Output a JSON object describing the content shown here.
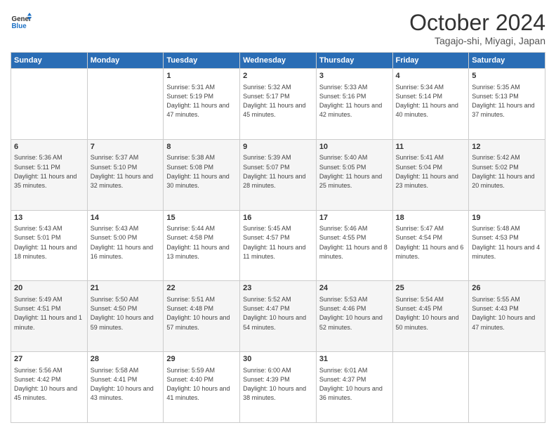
{
  "logo": {
    "text_general": "General",
    "text_blue": "Blue"
  },
  "header": {
    "month": "October 2024",
    "location": "Tagajo-shi, Miyagi, Japan"
  },
  "weekdays": [
    "Sunday",
    "Monday",
    "Tuesday",
    "Wednesday",
    "Thursday",
    "Friday",
    "Saturday"
  ],
  "rows": [
    [
      {
        "day": "",
        "sunrise": "",
        "sunset": "",
        "daylight": ""
      },
      {
        "day": "",
        "sunrise": "",
        "sunset": "",
        "daylight": ""
      },
      {
        "day": "1",
        "sunrise": "Sunrise: 5:31 AM",
        "sunset": "Sunset: 5:19 PM",
        "daylight": "Daylight: 11 hours and 47 minutes."
      },
      {
        "day": "2",
        "sunrise": "Sunrise: 5:32 AM",
        "sunset": "Sunset: 5:17 PM",
        "daylight": "Daylight: 11 hours and 45 minutes."
      },
      {
        "day": "3",
        "sunrise": "Sunrise: 5:33 AM",
        "sunset": "Sunset: 5:16 PM",
        "daylight": "Daylight: 11 hours and 42 minutes."
      },
      {
        "day": "4",
        "sunrise": "Sunrise: 5:34 AM",
        "sunset": "Sunset: 5:14 PM",
        "daylight": "Daylight: 11 hours and 40 minutes."
      },
      {
        "day": "5",
        "sunrise": "Sunrise: 5:35 AM",
        "sunset": "Sunset: 5:13 PM",
        "daylight": "Daylight: 11 hours and 37 minutes."
      }
    ],
    [
      {
        "day": "6",
        "sunrise": "Sunrise: 5:36 AM",
        "sunset": "Sunset: 5:11 PM",
        "daylight": "Daylight: 11 hours and 35 minutes."
      },
      {
        "day": "7",
        "sunrise": "Sunrise: 5:37 AM",
        "sunset": "Sunset: 5:10 PM",
        "daylight": "Daylight: 11 hours and 32 minutes."
      },
      {
        "day": "8",
        "sunrise": "Sunrise: 5:38 AM",
        "sunset": "Sunset: 5:08 PM",
        "daylight": "Daylight: 11 hours and 30 minutes."
      },
      {
        "day": "9",
        "sunrise": "Sunrise: 5:39 AM",
        "sunset": "Sunset: 5:07 PM",
        "daylight": "Daylight: 11 hours and 28 minutes."
      },
      {
        "day": "10",
        "sunrise": "Sunrise: 5:40 AM",
        "sunset": "Sunset: 5:05 PM",
        "daylight": "Daylight: 11 hours and 25 minutes."
      },
      {
        "day": "11",
        "sunrise": "Sunrise: 5:41 AM",
        "sunset": "Sunset: 5:04 PM",
        "daylight": "Daylight: 11 hours and 23 minutes."
      },
      {
        "day": "12",
        "sunrise": "Sunrise: 5:42 AM",
        "sunset": "Sunset: 5:02 PM",
        "daylight": "Daylight: 11 hours and 20 minutes."
      }
    ],
    [
      {
        "day": "13",
        "sunrise": "Sunrise: 5:43 AM",
        "sunset": "Sunset: 5:01 PM",
        "daylight": "Daylight: 11 hours and 18 minutes."
      },
      {
        "day": "14",
        "sunrise": "Sunrise: 5:43 AM",
        "sunset": "Sunset: 5:00 PM",
        "daylight": "Daylight: 11 hours and 16 minutes."
      },
      {
        "day": "15",
        "sunrise": "Sunrise: 5:44 AM",
        "sunset": "Sunset: 4:58 PM",
        "daylight": "Daylight: 11 hours and 13 minutes."
      },
      {
        "day": "16",
        "sunrise": "Sunrise: 5:45 AM",
        "sunset": "Sunset: 4:57 PM",
        "daylight": "Daylight: 11 hours and 11 minutes."
      },
      {
        "day": "17",
        "sunrise": "Sunrise: 5:46 AM",
        "sunset": "Sunset: 4:55 PM",
        "daylight": "Daylight: 11 hours and 8 minutes."
      },
      {
        "day": "18",
        "sunrise": "Sunrise: 5:47 AM",
        "sunset": "Sunset: 4:54 PM",
        "daylight": "Daylight: 11 hours and 6 minutes."
      },
      {
        "day": "19",
        "sunrise": "Sunrise: 5:48 AM",
        "sunset": "Sunset: 4:53 PM",
        "daylight": "Daylight: 11 hours and 4 minutes."
      }
    ],
    [
      {
        "day": "20",
        "sunrise": "Sunrise: 5:49 AM",
        "sunset": "Sunset: 4:51 PM",
        "daylight": "Daylight: 11 hours and 1 minute."
      },
      {
        "day": "21",
        "sunrise": "Sunrise: 5:50 AM",
        "sunset": "Sunset: 4:50 PM",
        "daylight": "Daylight: 10 hours and 59 minutes."
      },
      {
        "day": "22",
        "sunrise": "Sunrise: 5:51 AM",
        "sunset": "Sunset: 4:48 PM",
        "daylight": "Daylight: 10 hours and 57 minutes."
      },
      {
        "day": "23",
        "sunrise": "Sunrise: 5:52 AM",
        "sunset": "Sunset: 4:47 PM",
        "daylight": "Daylight: 10 hours and 54 minutes."
      },
      {
        "day": "24",
        "sunrise": "Sunrise: 5:53 AM",
        "sunset": "Sunset: 4:46 PM",
        "daylight": "Daylight: 10 hours and 52 minutes."
      },
      {
        "day": "25",
        "sunrise": "Sunrise: 5:54 AM",
        "sunset": "Sunset: 4:45 PM",
        "daylight": "Daylight: 10 hours and 50 minutes."
      },
      {
        "day": "26",
        "sunrise": "Sunrise: 5:55 AM",
        "sunset": "Sunset: 4:43 PM",
        "daylight": "Daylight: 10 hours and 47 minutes."
      }
    ],
    [
      {
        "day": "27",
        "sunrise": "Sunrise: 5:56 AM",
        "sunset": "Sunset: 4:42 PM",
        "daylight": "Daylight: 10 hours and 45 minutes."
      },
      {
        "day": "28",
        "sunrise": "Sunrise: 5:58 AM",
        "sunset": "Sunset: 4:41 PM",
        "daylight": "Daylight: 10 hours and 43 minutes."
      },
      {
        "day": "29",
        "sunrise": "Sunrise: 5:59 AM",
        "sunset": "Sunset: 4:40 PM",
        "daylight": "Daylight: 10 hours and 41 minutes."
      },
      {
        "day": "30",
        "sunrise": "Sunrise: 6:00 AM",
        "sunset": "Sunset: 4:39 PM",
        "daylight": "Daylight: 10 hours and 38 minutes."
      },
      {
        "day": "31",
        "sunrise": "Sunrise: 6:01 AM",
        "sunset": "Sunset: 4:37 PM",
        "daylight": "Daylight: 10 hours and 36 minutes."
      },
      {
        "day": "",
        "sunrise": "",
        "sunset": "",
        "daylight": ""
      },
      {
        "day": "",
        "sunrise": "",
        "sunset": "",
        "daylight": ""
      }
    ]
  ]
}
